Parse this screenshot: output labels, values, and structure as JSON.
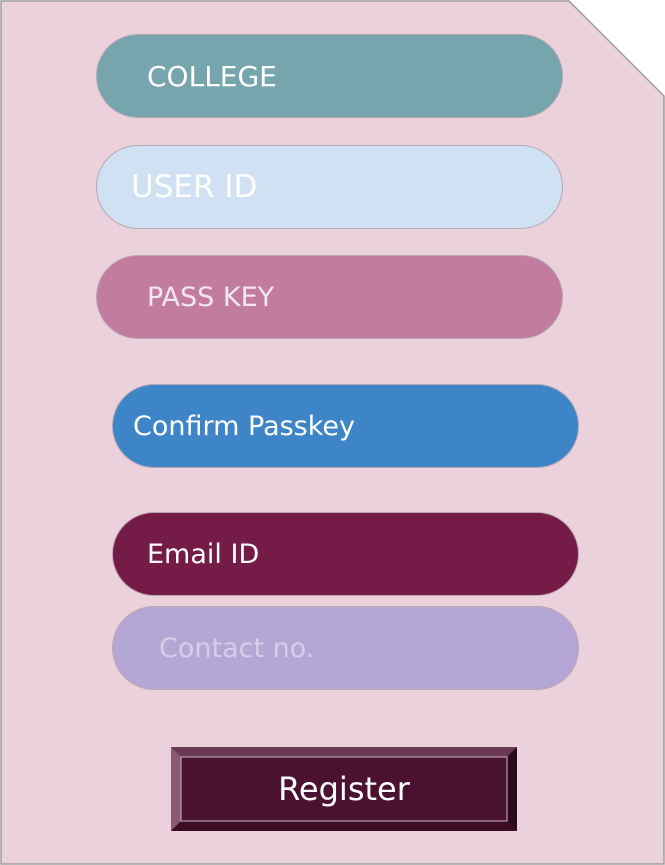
{
  "form": {
    "fields": [
      {
        "label": "COLLEGE",
        "bg": "#76a5ae",
        "color": "#ffffff"
      },
      {
        "label": "USER ID",
        "bg": "#cfe1f3",
        "color": "#ffffff"
      },
      {
        "label": "PASS KEY",
        "bg": "#c27c9f",
        "color": "#f3e6ee"
      },
      {
        "label": "Confirm Passkey",
        "bg": "#3d85c6",
        "color": "#ffffff"
      },
      {
        "label": "Email ID",
        "bg": "#741b47",
        "color": "#ffffff"
      },
      {
        "label": "Contact no.",
        "bg": "#b4a7d6",
        "color": "#d6cdea"
      }
    ],
    "register_label": "Register"
  },
  "colors": {
    "page_background": "#ead1dc",
    "page_border": "#9e9e9e",
    "button_background": "#4a1130",
    "button_bevel": "#6d3a55"
  }
}
